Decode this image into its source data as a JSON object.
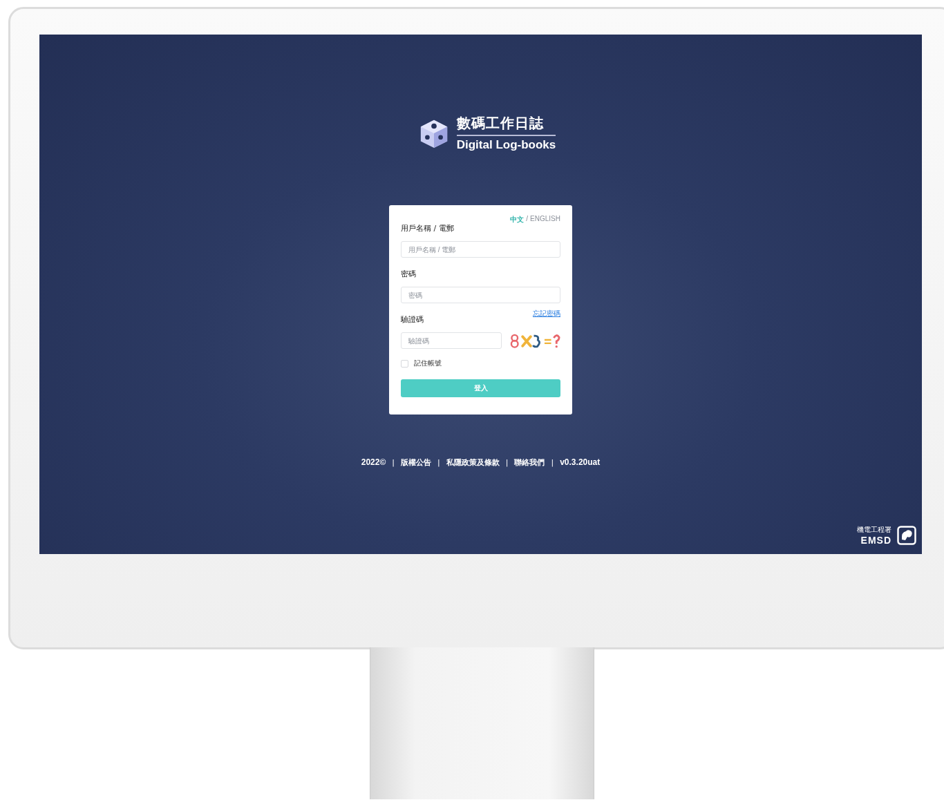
{
  "logo": {
    "title_zh": "數碼工作日誌",
    "title_en": "Digital Log-books"
  },
  "login": {
    "language": {
      "options": [
        {
          "label": "中文",
          "selected": true
        },
        {
          "label": "ENGLISH",
          "selected": false
        }
      ],
      "separator": "/"
    },
    "fields": [
      {
        "kind": "text",
        "label": "用戶名稱 / 電郵",
        "placeholder": "用戶名稱 / 電郵"
      },
      {
        "kind": "password",
        "label": "密碼",
        "placeholder": "密碼"
      },
      {
        "kind": "captcha",
        "label": "驗證碼",
        "placeholder": "驗證碼",
        "link": "忘記密碼"
      }
    ],
    "remember": {
      "label": "記住帳號",
      "checked": false
    },
    "submit": "登入"
  },
  "footer": {
    "items": [
      {
        "kind": "text",
        "text": "2022©"
      },
      {
        "kind": "separator",
        "text": "|"
      },
      {
        "kind": "link",
        "text": "版權公告"
      },
      {
        "kind": "separator",
        "text": "|"
      },
      {
        "kind": "link",
        "text": "私隱政策及條款"
      },
      {
        "kind": "separator",
        "text": "|"
      },
      {
        "kind": "link",
        "text": "聯絡我們"
      },
      {
        "kind": "separator",
        "text": "|"
      },
      {
        "kind": "text",
        "text": "v0.3.20uat"
      }
    ]
  },
  "brand": {
    "name_zh": "機電工程署",
    "name_en": "EMSD"
  }
}
